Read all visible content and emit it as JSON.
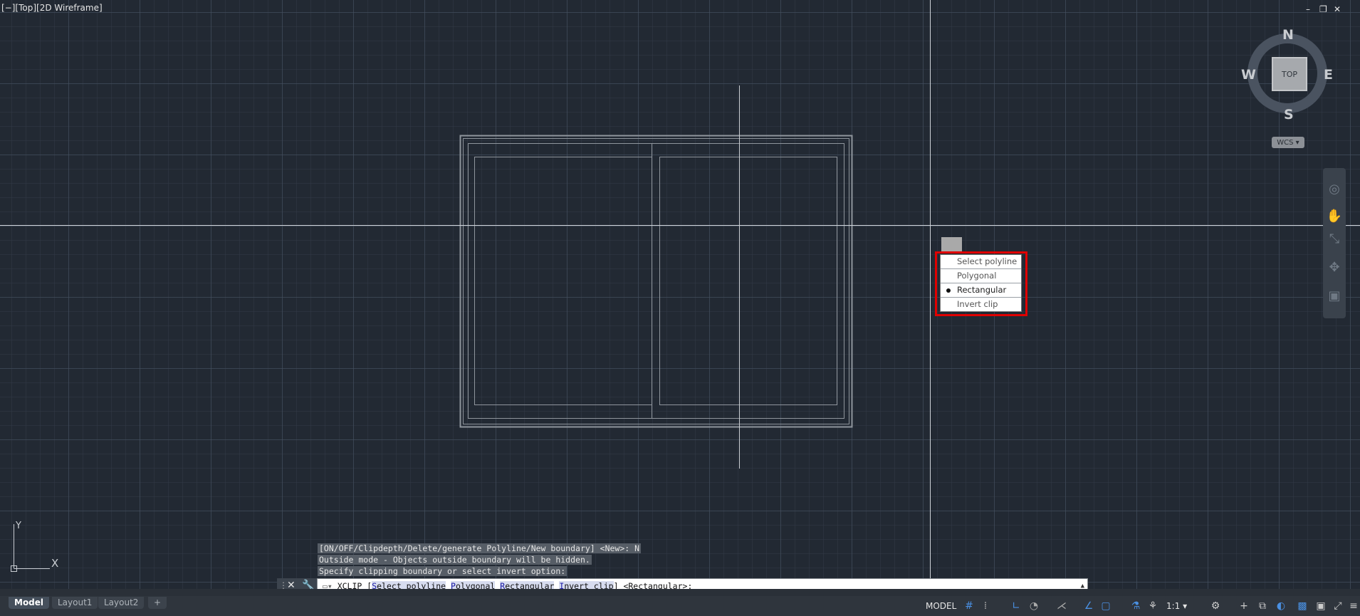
{
  "viewport": {
    "label": "[−][Top][2D Wireframe]",
    "window_controls": [
      "–",
      "❐",
      "✕"
    ]
  },
  "viewcube": {
    "top_label": "TOP",
    "north": "N",
    "south": "S",
    "east": "E",
    "west": "W",
    "wcs_label": "WCS ▾"
  },
  "clip_menu": {
    "items": [
      {
        "label": "Select polyline",
        "selected": false
      },
      {
        "label": "Polygonal",
        "selected": false
      },
      {
        "label": "Rectangular",
        "selected": true
      },
      {
        "label": "Invert clip",
        "selected": false
      }
    ]
  },
  "ucs": {
    "x_label": "X",
    "y_label": "Y"
  },
  "command_history": [
    "[ON/OFF/Clipdepth/Delete/generate Polyline/New boundary] <New>: N",
    "Outside mode - Objects outside boundary will be hidden.",
    "Specify clipping boundary or select invert option:"
  ],
  "command_line": {
    "command": "XCLIP",
    "options": [
      {
        "key": "S",
        "rest": "elect polyline"
      },
      {
        "key": "P",
        "rest": "olygonal"
      },
      {
        "key": "R",
        "rest": "ectangular"
      },
      {
        "key": "I",
        "rest": "nvert clip"
      }
    ],
    "default": "<Rectangular>:"
  },
  "tabs": [
    "Model",
    "Layout1",
    "Layout2",
    "+"
  ],
  "status": {
    "space": "MODEL",
    "scale": "1:1 ▾"
  },
  "colors": {
    "accent_red": "#e00000",
    "background": "#222933",
    "option_link": "#1a1aa6"
  }
}
